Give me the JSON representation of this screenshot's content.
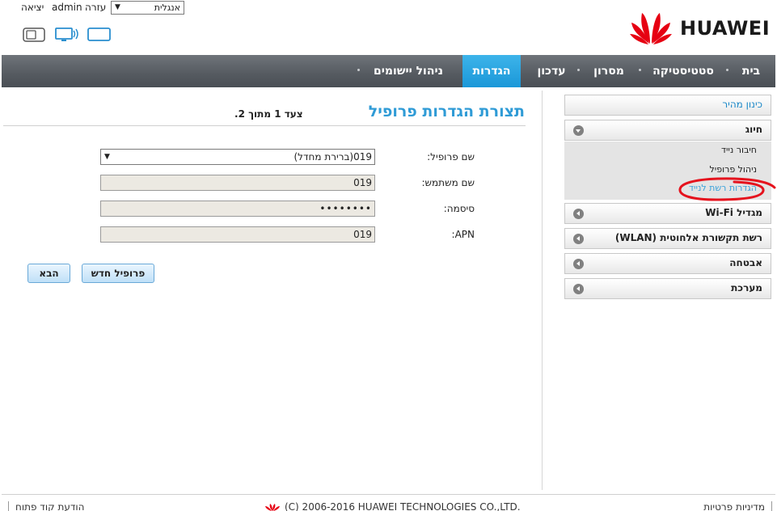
{
  "header": {
    "logout": "יציאה",
    "user": "admin",
    "help": "עזרה",
    "language": "אנגלית",
    "brand": "HUAWEI"
  },
  "icons": {
    "device_icons": [
      "sim-icon",
      "computer-wifi-icon",
      "tablet-icon"
    ],
    "brand_icon": "huawei-flower-logo"
  },
  "colors": {
    "nav_bg": "#555a60",
    "nav_active": "#1a97d8",
    "title_blue": "#2f9bd6",
    "brand_red": "#e60012",
    "annotation_red": "#e5121d"
  },
  "nav": {
    "items": [
      {
        "label": "בית",
        "active": false
      },
      {
        "label": "סטטיסטיקה",
        "active": false
      },
      {
        "label": "מסרון",
        "active": false
      },
      {
        "label": "עדכון",
        "active": false
      },
      {
        "label": "הגדרות",
        "active": true
      },
      {
        "label": "ניהול יישומים",
        "active": false
      }
    ]
  },
  "sidebar": {
    "quick_setup": "כינון מהיר",
    "dialup": "חיוג",
    "dialup_items": [
      "חיבור נייד",
      "ניהול פרופיל",
      "הגדרות רשת לנייד"
    ],
    "wifi_extender": "מגדיל Wi-Fi",
    "wlan": "רשת תקשורת אלחוטית (WLAN)",
    "security": "אבטחה",
    "system": "מערכת"
  },
  "main": {
    "title": "תצורת הגדרות פרופיל",
    "step": "צעד 1 מתוך 2.",
    "fields": [
      {
        "label": "שם פרופיל:",
        "value": "019(ברירת מחדל)",
        "type": "select"
      },
      {
        "label": "שם משתמש:",
        "value": "019",
        "type": "text"
      },
      {
        "label": "סיסמה:",
        "value": "••••••••",
        "type": "password"
      },
      {
        "label": "APN:",
        "value": "019",
        "type": "text"
      }
    ],
    "new_profile_button": "פרופיל חדש",
    "next_button": "הבא"
  },
  "footer": {
    "privacy": "מדיניות פרטיות",
    "copyright": "(C) 2006-2016 HUAWEI TECHNOLOGIES CO.,LTD.",
    "open_source": "הודעת קוד פתוח"
  }
}
